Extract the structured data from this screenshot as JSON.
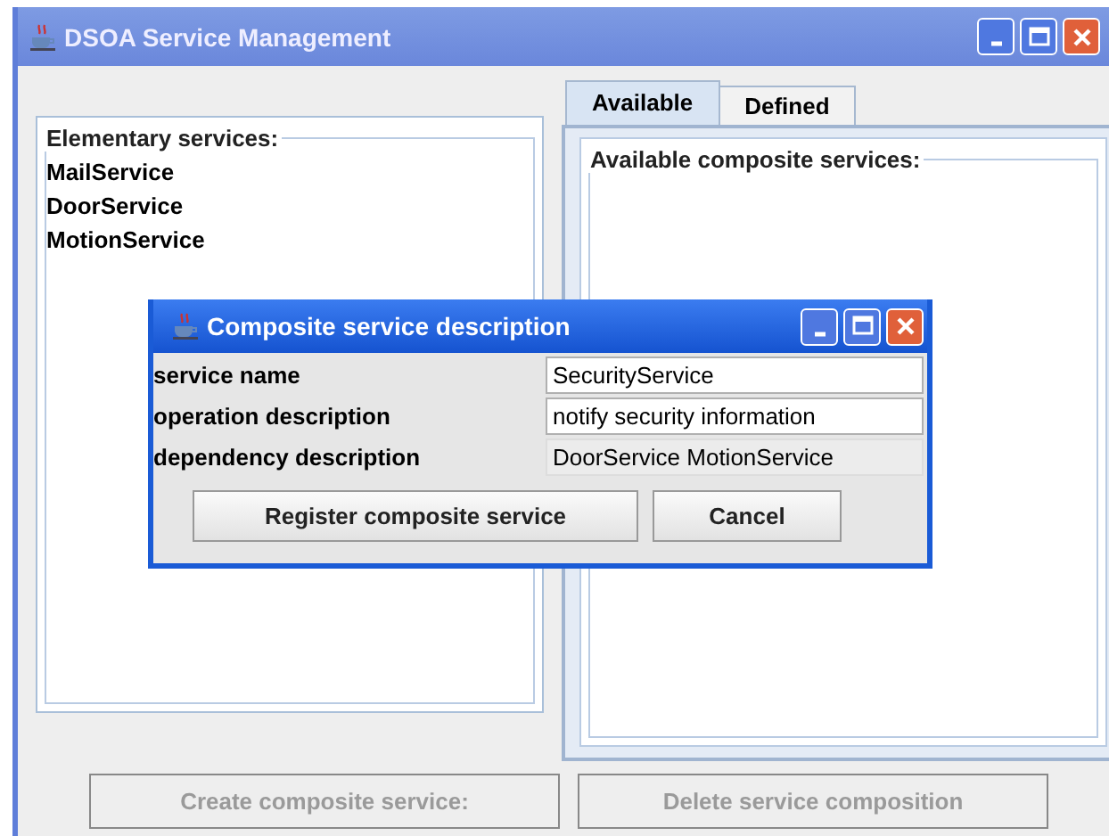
{
  "window": {
    "title": "DSOA Service Management"
  },
  "elementary_services": {
    "title": "Elementary services:",
    "items": [
      "MailService",
      "DoorService",
      "MotionService"
    ]
  },
  "tabs": [
    {
      "label": "Available",
      "selected": true
    },
    {
      "label": "Defined",
      "selected": false
    }
  ],
  "available_panel": {
    "title": "Available composite services:"
  },
  "buttons": [
    {
      "label": "Create composite service:",
      "disabled": true
    },
    {
      "label": "Delete service composition",
      "disabled": true
    }
  ],
  "dialog": {
    "title": "Composite service description",
    "fields": [
      {
        "label": "service name",
        "value": "SecurityService",
        "editable": true
      },
      {
        "label": "operation description",
        "value": "notify security information",
        "editable": true
      },
      {
        "label": "dependency description",
        "value": "DoorService MotionService",
        "editable": false
      }
    ],
    "buttons": [
      {
        "label": "Register composite service"
      },
      {
        "label": "Cancel"
      }
    ]
  }
}
